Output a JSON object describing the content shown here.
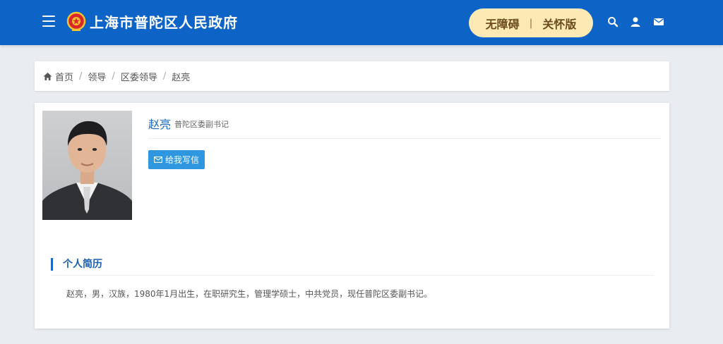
{
  "header": {
    "site_title": "上海市普陀区人民政府",
    "accessibility_label": "无障碍",
    "elder_mode_label": "关怀版",
    "separator": "|",
    "icons": [
      "menu-icon",
      "emblem-icon",
      "search-icon",
      "user-icon",
      "mail-icon"
    ]
  },
  "breadcrumb": {
    "home": "首页",
    "level1": "领导",
    "level2": "区委领导",
    "current": "赵亮",
    "sep": "/"
  },
  "profile": {
    "name": "赵亮",
    "position": "普陀区委副书记",
    "write_letter_label": "给我写信",
    "section_title": "个人简历",
    "bio": "赵亮，男，汉族，1980年1月出生，在职研究生，管理学硕士，中共党员，现任普陀区委副书记。"
  },
  "colors": {
    "header_bg": "#0e63c7",
    "access_pill_bg": "#fde9b4",
    "accent_blue": "#1b6ac4",
    "button_blue": "#2f97e0",
    "page_bg": "#e9edf1"
  }
}
